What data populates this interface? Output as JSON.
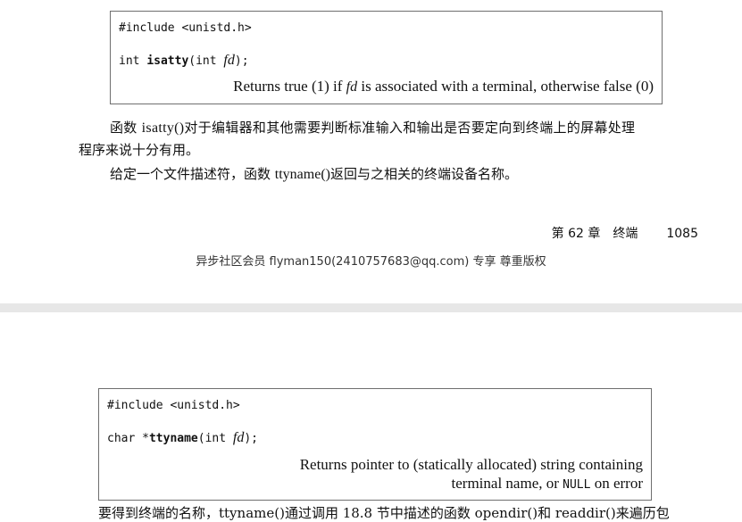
{
  "top_section": {
    "code_box": {
      "include_line": "#include <unistd.h>",
      "signature": {
        "return_type": "int ",
        "function_name": "isatty",
        "param_type": "(int ",
        "param_name": "fd",
        "closing": ");"
      },
      "description": {
        "before_fd": "Returns true (1) if ",
        "fd": "fd",
        "after_fd": " is associated with a terminal, otherwise false (0)"
      }
    },
    "paragraphs": {
      "p1_line1_prefix": "函数 ",
      "p1_line1_func": "isatty()",
      "p1_line1_suffix": "对于编辑器和其他需要判断标准输入和输出是否要定向到终端上的屏幕处理",
      "p1_line2": "程序来说十分有用。",
      "p2_prefix": "给定一个文件描述符，函数 ",
      "p2_func": "ttyname()",
      "p2_suffix": "返回与之相关的终端设备名称。"
    },
    "footer": {
      "chapter": "第 62 章",
      "chapter_title": "终端",
      "page_number": "1085"
    },
    "watermark": "异步社区会员 flyman150(2410757683@qq.com) 专享 尊重版权"
  },
  "bottom_section": {
    "code_box": {
      "include_line": "#include <unistd.h>",
      "signature": {
        "return_type": "char *",
        "function_name": "ttyname",
        "param_type": "(int ",
        "param_name": "fd",
        "closing": ");"
      },
      "description": {
        "line1": "Returns pointer to (statically allocated) string containing",
        "line2_before_null": "terminal name, or ",
        "null_token": "NULL",
        "line2_after_null": " on error"
      }
    },
    "cutoff_text": "要得到终端的名称，ttyname()通过调用 18.8 节中描述的函数 opendir()和 readdir()来遍历包"
  }
}
